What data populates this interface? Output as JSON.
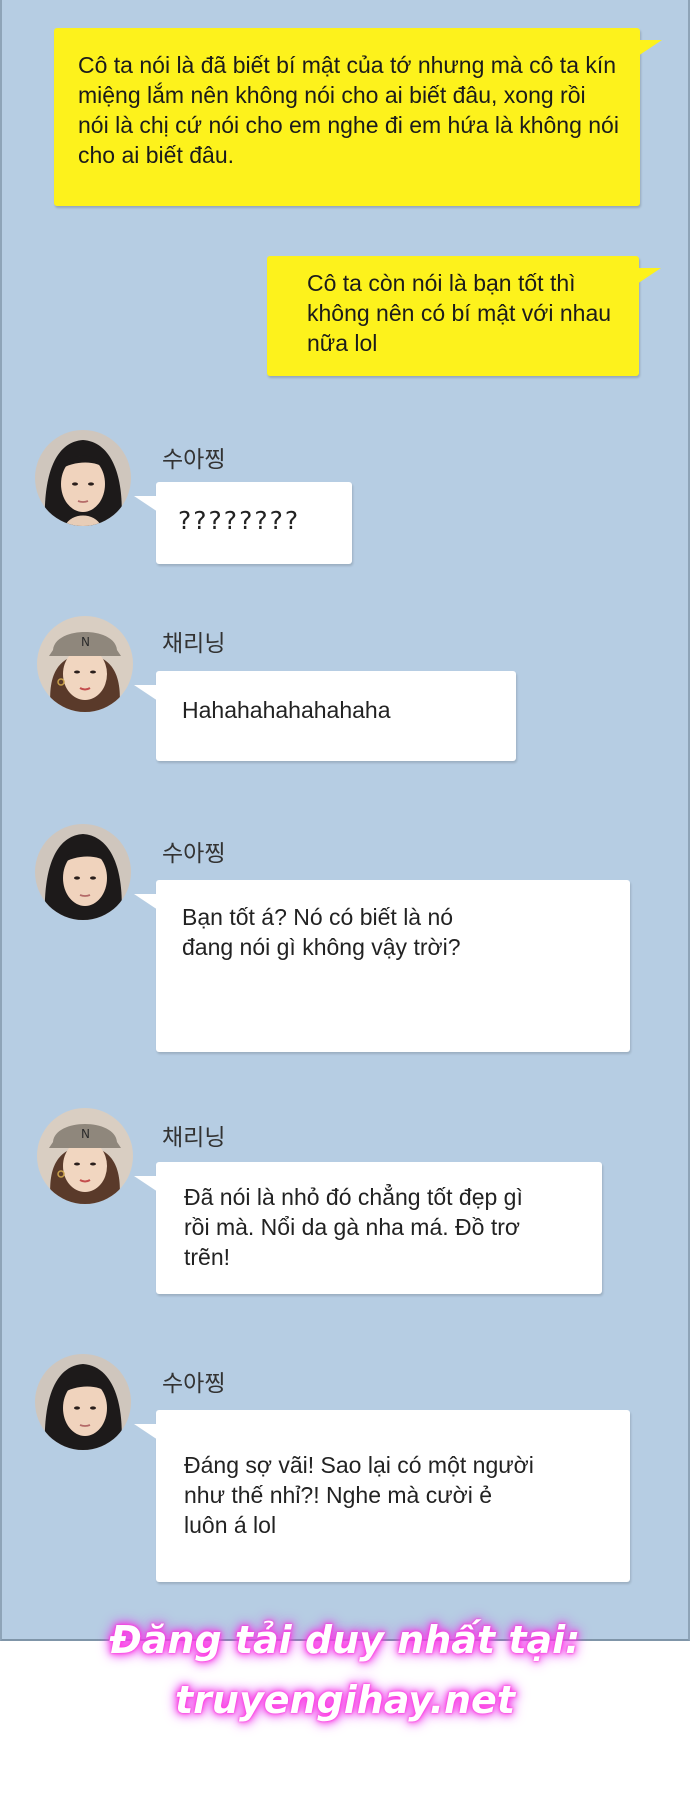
{
  "messages": [
    {
      "side": "out",
      "text": "Cô ta nói là đã biết bí mật của tớ nhưng mà cô ta kín miệng lắm nên không nói cho ai biết đâu, xong rồi nói là chị cứ nói cho em nghe đi em hứa là không nói cho ai biết đâu."
    },
    {
      "side": "out",
      "text": "Cô ta còn nói là bạn tốt thì không nên có bí mật với nhau nữa lol"
    },
    {
      "side": "in",
      "sender": "수아찡",
      "text": "????????"
    },
    {
      "side": "in",
      "sender": "채리닝",
      "text": "Hahahahahahahaha"
    },
    {
      "side": "in",
      "sender": "수아찡",
      "text": "Bạn tốt á? Nó có biết là nó đang nói gì không vậy trời?"
    },
    {
      "side": "in",
      "sender": "채리닝",
      "text": "Đã nói là nhỏ đó chẳng tốt đẹp gì rồi mà. Nổi da gà nha má. Đồ trơ trẽn!"
    },
    {
      "side": "in",
      "sender": "수아찡",
      "text": "Đáng sợ vãi! Sao lại có một người như thế nhỉ?! Nghe mà cười ẻ luôn á lol"
    }
  ],
  "watermark": "Đăng tải duy nhất tại: truyengihay.net",
  "colors": {
    "chat_background": "#b6cde3",
    "outgoing_bubble": "#fdf21c",
    "incoming_bubble": "#ffffff",
    "watermark_glow": "#ff3de0"
  }
}
